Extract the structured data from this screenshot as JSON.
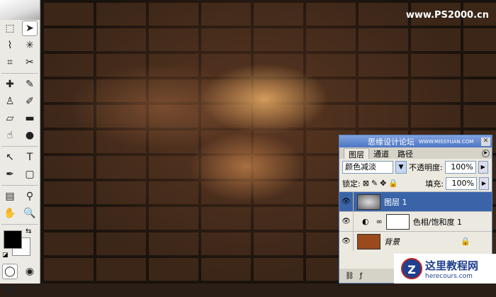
{
  "watermark": "www.PS2000.cn",
  "toolbox": {
    "tools": [
      [
        "rectangular-marquee",
        "move"
      ],
      [
        "lasso",
        "magic-wand"
      ],
      [
        "crop",
        "slice"
      ],
      [
        "healing-brush",
        "brush"
      ],
      [
        "clone-stamp",
        "history-brush"
      ],
      [
        "eraser",
        "gradient"
      ],
      [
        "smudge",
        "burn"
      ],
      [
        "path-selection",
        "type"
      ],
      [
        "pen",
        "rectangle"
      ],
      [
        "notes",
        "eyedropper"
      ],
      [
        "hand",
        "zoom"
      ]
    ],
    "glyphs": [
      [
        "⬚",
        "➤"
      ],
      [
        "⌇",
        "✳"
      ],
      [
        "⌗",
        "✂"
      ],
      [
        "✚",
        "✎"
      ],
      [
        "♙",
        "✐"
      ],
      [
        "▱",
        "▬"
      ],
      [
        "☝",
        "●"
      ],
      [
        "↖",
        "T"
      ],
      [
        "✒",
        "▢"
      ],
      [
        "▤",
        "⚲"
      ],
      [
        "✋",
        "🔍"
      ]
    ]
  },
  "panel": {
    "title": "思缘设计论坛",
    "title_sub": "WWW.MISSYUAN.COM",
    "tabs": [
      "图层",
      "通道",
      "路径"
    ],
    "blend_mode": "颜色减淡",
    "opacity_label": "不透明度:",
    "opacity": "100%",
    "lock_label": "锁定:",
    "fill_label": "填充:",
    "fill": "100%",
    "layers": [
      {
        "name": "图层 1",
        "selected": true
      },
      {
        "name": "色相/饱和度 1",
        "selected": false
      },
      {
        "name": "背景",
        "selected": false
      }
    ]
  },
  "logo": {
    "title": "这里教程网",
    "url": "herecours.com"
  }
}
